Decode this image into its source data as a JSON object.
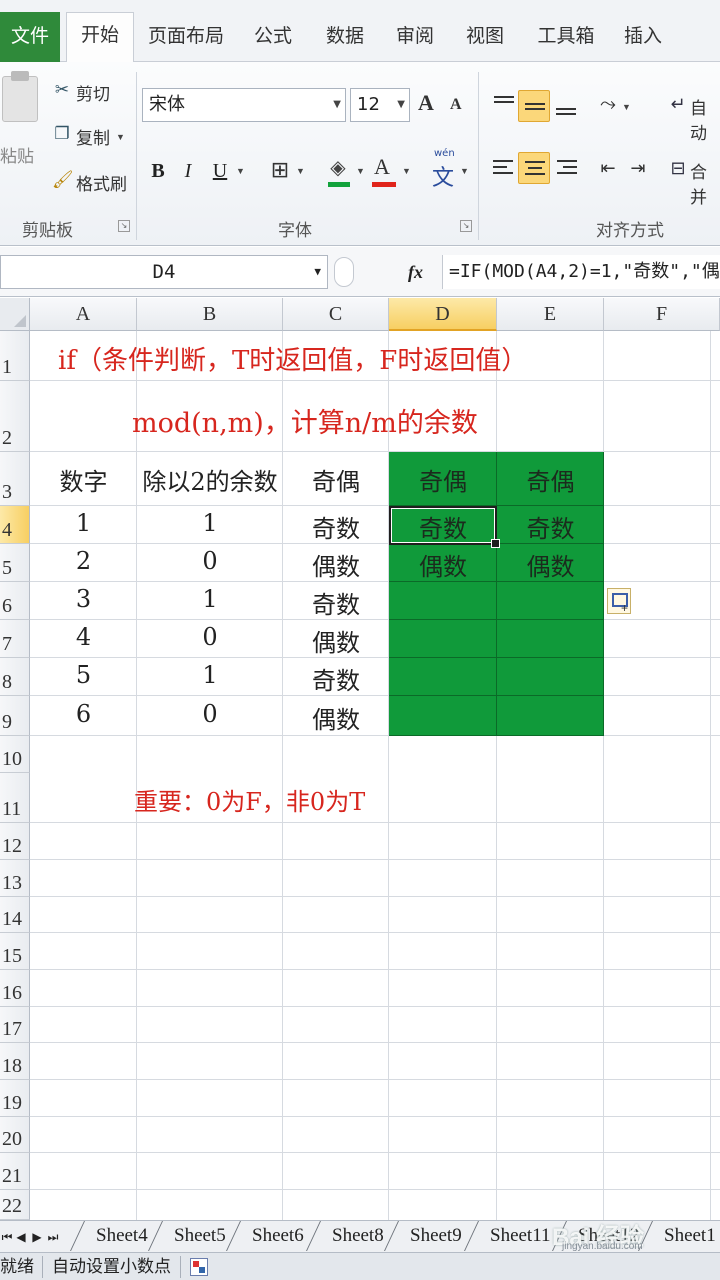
{
  "ribbon_tabs": {
    "file": "文件",
    "home": "开始",
    "page_layout": "页面布局",
    "formulas": "公式",
    "data": "数据",
    "review": "审阅",
    "view": "视图",
    "toolbox": "工具箱",
    "insert": "插入"
  },
  "clipboard": {
    "paste": "粘贴",
    "cut": "剪切",
    "copy": "复制",
    "format_painter": "格式刷",
    "group_label": "剪贴板"
  },
  "font": {
    "name": "宋体",
    "size": "12",
    "grow": "A",
    "shrink": "A",
    "bold": "B",
    "italic": "I",
    "underline": "U",
    "font_color_letter": "A",
    "phonetic": "wén",
    "phonetic_char": "文",
    "group_label": "字体"
  },
  "alignment": {
    "wrap_text": "自动",
    "merge": "合并",
    "group_label": "对齐方式"
  },
  "formula_bar": {
    "name_box": "D4",
    "fx_label": "fx",
    "formula": "=IF(MOD(A4,2)=1,\"奇数\",\"偶"
  },
  "columns": [
    "A",
    "B",
    "C",
    "D",
    "E",
    "F"
  ],
  "selected_column": "D",
  "rows": [
    "1",
    "2",
    "3",
    "4",
    "5",
    "6",
    "7",
    "8",
    "9",
    "10",
    "11",
    "12",
    "13",
    "14",
    "15",
    "16",
    "17",
    "18",
    "19",
    "20",
    "21",
    "22"
  ],
  "selected_row": "4",
  "notes": {
    "row1": "if（条件判断，T时返回值，F时返回值）",
    "row2": "mod(n,m)，计算n/m的余数",
    "row11": "重要：0为F，非0为T"
  },
  "table": {
    "headers": [
      "数字",
      "除以2的余数",
      "奇偶",
      "奇偶",
      "奇偶"
    ],
    "rows": [
      [
        "1",
        "1",
        "奇数",
        "奇数",
        "奇数"
      ],
      [
        "2",
        "0",
        "偶数",
        "偶数",
        "偶数"
      ],
      [
        "3",
        "1",
        "奇数",
        "",
        ""
      ],
      [
        "4",
        "0",
        "偶数",
        "",
        ""
      ],
      [
        "5",
        "1",
        "奇数",
        "",
        ""
      ],
      [
        "6",
        "0",
        "偶数",
        "",
        ""
      ]
    ]
  },
  "colors": {
    "file_tab": "#2f8a3a",
    "highlight_fill": "#109a3a",
    "note_text": "#d7261e",
    "selected_header": "#f7cf62"
  },
  "sheets": [
    "Sheet4",
    "Sheet5",
    "Sheet6",
    "Sheet8",
    "Sheet9",
    "Sheet11",
    "Sheet12",
    "Sheet1"
  ],
  "watermark": {
    "logo": "Bai 经验",
    "url": "jingyan.baidu.com"
  },
  "status_bar": {
    "ready": "就绪",
    "auto_decimal": "自动设置小数点"
  }
}
